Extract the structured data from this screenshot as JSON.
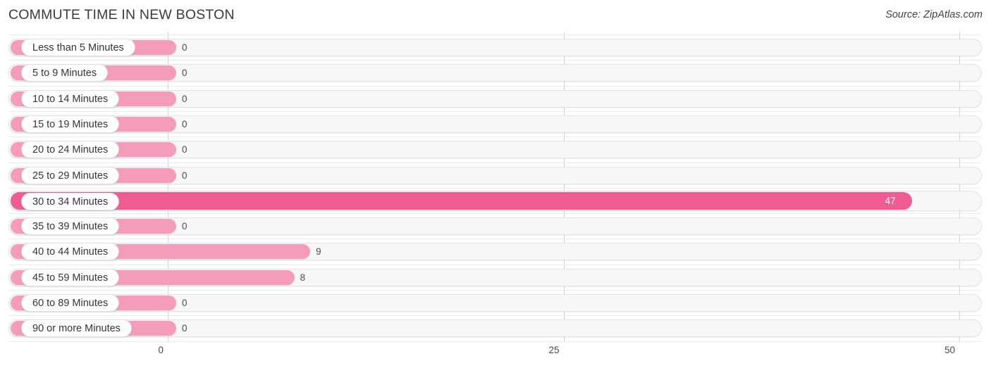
{
  "header": {
    "title": "COMMUTE TIME IN NEW BOSTON",
    "source": "Source: ZipAtlas.com"
  },
  "colors": {
    "bar": "#f59cbb",
    "bar_highlight": "#ef5c91",
    "track": "#f7f7f7",
    "gridline": "#cfcfcf",
    "text": "#34343c"
  },
  "chart_data": {
    "type": "bar",
    "orientation": "horizontal",
    "title": "COMMUTE TIME IN NEW BOSTON",
    "xlabel": "",
    "ylabel": "",
    "xlim": [
      0,
      50
    ],
    "xticks": [
      0,
      25,
      50
    ],
    "xtick_labels": [
      "0",
      "25",
      "50"
    ],
    "grid": true,
    "legend": null,
    "categories": [
      "Less than 5 Minutes",
      "5 to 9 Minutes",
      "10 to 14 Minutes",
      "15 to 19 Minutes",
      "20 to 24 Minutes",
      "25 to 29 Minutes",
      "30 to 34 Minutes",
      "35 to 39 Minutes",
      "40 to 44 Minutes",
      "45 to 59 Minutes",
      "60 to 89 Minutes",
      "90 or more Minutes"
    ],
    "values": [
      0,
      0,
      0,
      0,
      0,
      0,
      47,
      0,
      9,
      8,
      0,
      0
    ],
    "value_labels": [
      "0",
      "0",
      "0",
      "0",
      "0",
      "0",
      "47",
      "0",
      "9",
      "8",
      "0",
      "0"
    ],
    "highlight_index": 6
  }
}
